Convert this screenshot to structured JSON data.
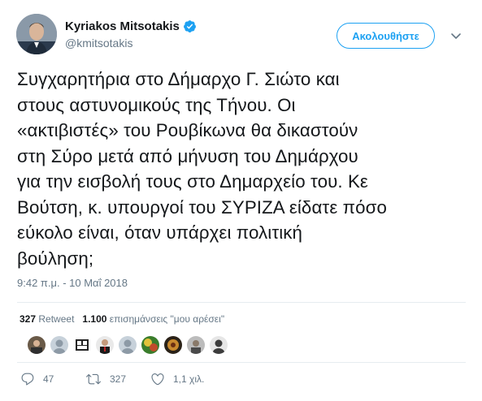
{
  "author": {
    "name": "Kyriakos Mitsotakis",
    "handle": "@kmitsotakis",
    "verified": true
  },
  "follow_button": {
    "label": "Ακολουθήστε"
  },
  "tweet": {
    "lines": [
      "Συγχαρητήρια στο Δήμαρχο Γ. Σιώτο και",
      "στους αστυνομικούς της Τήνου. Οι",
      "«ακτιβιστές» του Ρουβίκωνα θα δικαστούν",
      "στη Σύρο μετά από μήνυση του Δημάρχου",
      "για την εισβολή τους στο Δημαρχείο του. Κε",
      "Βούτση, κ. υπουργοί του ΣΥΡΙΖΑ είδατε πόσο",
      "εύκολο είναι, όταν υπάρχει πολιτική",
      "βούληση;"
    ],
    "timestamp": "9:42 π.μ. - 10 Μαΐ 2018"
  },
  "stats": {
    "retweets_count": "327",
    "retweets_label": "Retweet",
    "likes_count": "1.100",
    "likes_label": "επισημάνσεις \"μου αρέσει\""
  },
  "actions": {
    "reply_count": "47",
    "retweet_count": "327",
    "like_count": "1,1 χιλ."
  },
  "colors": {
    "accent": "#1da1f2",
    "muted": "#657786",
    "text": "#14171a",
    "divider": "#e6ecf0"
  },
  "icons": [
    "verified-badge-icon",
    "chevron-down-icon",
    "reply-icon",
    "retweet-icon",
    "heart-icon"
  ]
}
